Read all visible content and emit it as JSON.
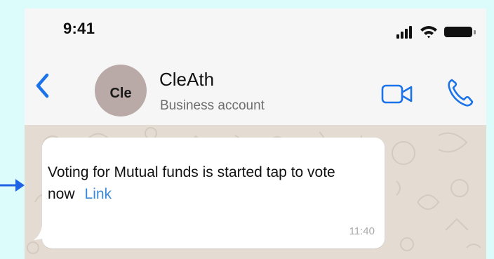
{
  "status_bar": {
    "time": "9:41",
    "icons": [
      "signal-icon",
      "wifi-icon",
      "battery-icon"
    ]
  },
  "header": {
    "back_icon": "chevron-left-icon",
    "avatar_initials": "Cle",
    "contact_name": "CleAth",
    "contact_subtitle": "Business account",
    "video_icon": "video-camera-icon",
    "call_icon": "phone-icon"
  },
  "message": {
    "text": "Voting for Mutual funds is started tap to vote now",
    "link_label": "Link",
    "time": "11:40"
  },
  "colors": {
    "background": "#dcfbfb",
    "accent": "#1a73e8",
    "link": "#3a8ad8",
    "arrow": "#1e63e6",
    "avatar": "#b9aaa8",
    "chat_background": "#e4dcd3"
  }
}
